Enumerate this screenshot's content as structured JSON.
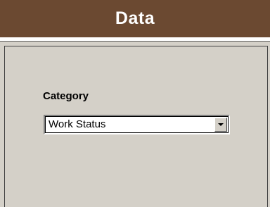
{
  "header": {
    "title": "Data",
    "background": "#6b4931"
  },
  "panel": {
    "category_label": "Category",
    "category_select": {
      "value": "Work Status",
      "icon": "chevron-down-icon"
    }
  }
}
